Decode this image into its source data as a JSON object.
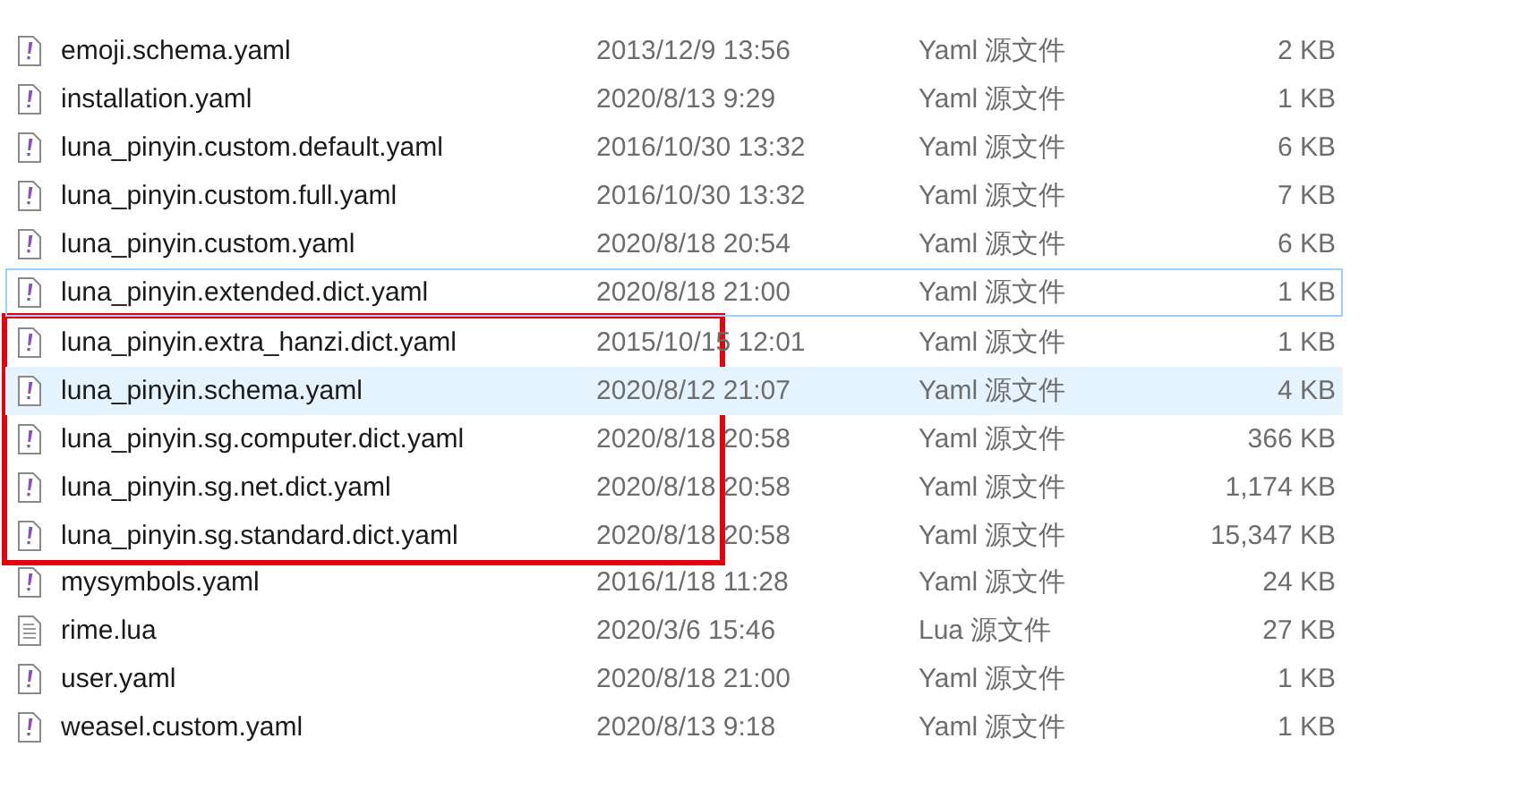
{
  "files": [
    {
      "kind": "yaml",
      "name": "emoji.schema.yaml",
      "date": "2013/12/9 13:56",
      "type": "Yaml 源文件",
      "size": "2 KB",
      "selected": false,
      "focused": false
    },
    {
      "kind": "yaml",
      "name": "installation.yaml",
      "date": "2020/8/13 9:29",
      "type": "Yaml 源文件",
      "size": "1 KB",
      "selected": false,
      "focused": false
    },
    {
      "kind": "yaml",
      "name": "luna_pinyin.custom.default.yaml",
      "date": "2016/10/30 13:32",
      "type": "Yaml 源文件",
      "size": "6 KB",
      "selected": false,
      "focused": false
    },
    {
      "kind": "yaml",
      "name": "luna_pinyin.custom.full.yaml",
      "date": "2016/10/30 13:32",
      "type": "Yaml 源文件",
      "size": "7 KB",
      "selected": false,
      "focused": false
    },
    {
      "kind": "yaml",
      "name": "luna_pinyin.custom.yaml",
      "date": "2020/8/18 20:54",
      "type": "Yaml 源文件",
      "size": "6 KB",
      "selected": false,
      "focused": false
    },
    {
      "kind": "yaml",
      "name": "luna_pinyin.extended.dict.yaml",
      "date": "2020/8/18 21:00",
      "type": "Yaml 源文件",
      "size": "1 KB",
      "selected": false,
      "focused": true
    },
    {
      "kind": "highlight-group",
      "files": [
        {
          "kind": "yaml",
          "name": "luna_pinyin.extra_hanzi.dict.yaml",
          "date": "2015/10/15 12:01",
          "type": "Yaml 源文件",
          "size": "1 KB",
          "selected": false,
          "focused": false
        },
        {
          "kind": "yaml",
          "name": "luna_pinyin.schema.yaml",
          "date": "2020/8/12 21:07",
          "type": "Yaml 源文件",
          "size": "4 KB",
          "selected": true,
          "focused": false
        },
        {
          "kind": "yaml",
          "name": "luna_pinyin.sg.computer.dict.yaml",
          "date": "2020/8/18 20:58",
          "type": "Yaml 源文件",
          "size": "366 KB",
          "selected": false,
          "focused": false
        },
        {
          "kind": "yaml",
          "name": "luna_pinyin.sg.net.dict.yaml",
          "date": "2020/8/18 20:58",
          "type": "Yaml 源文件",
          "size": "1,174 KB",
          "selected": false,
          "focused": false
        },
        {
          "kind": "yaml",
          "name": "luna_pinyin.sg.standard.dict.yaml",
          "date": "2020/8/18 20:58",
          "type": "Yaml 源文件",
          "size": "15,347 KB",
          "selected": false,
          "focused": false
        }
      ]
    },
    {
      "kind": "yaml",
      "name": "mysymbols.yaml",
      "date": "2016/1/18 11:28",
      "type": "Yaml 源文件",
      "size": "24 KB",
      "selected": false,
      "focused": false
    },
    {
      "kind": "text",
      "name": "rime.lua",
      "date": "2020/3/6 15:46",
      "type": "Lua 源文件",
      "size": "27 KB",
      "selected": false,
      "focused": false
    },
    {
      "kind": "yaml",
      "name": "user.yaml",
      "date": "2020/8/18 21:00",
      "type": "Yaml 源文件",
      "size": "1 KB",
      "selected": false,
      "focused": false
    },
    {
      "kind": "yaml",
      "name": "weasel.custom.yaml",
      "date": "2020/8/13 9:18",
      "type": "Yaml 源文件",
      "size": "1 KB",
      "selected": false,
      "focused": false
    }
  ]
}
